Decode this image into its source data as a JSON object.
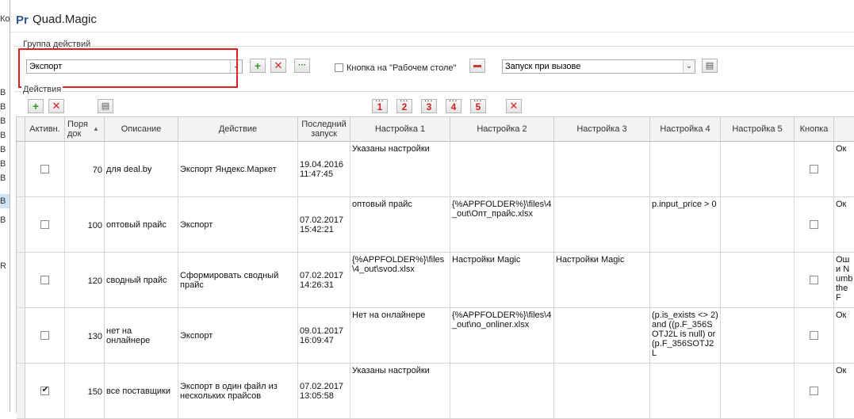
{
  "background_window": {
    "top_text": "Ко",
    "rows": [
      "B",
      "B",
      "B",
      "B",
      "B",
      "B",
      "B",
      "B",
      "B",
      "R"
    ]
  },
  "window": {
    "logo": "Pr",
    "title": "Quad.Magic"
  },
  "group_actions": {
    "label": "Группа действий",
    "combo_value": "Экспорт",
    "desktop_checkbox_label": "Кнопка на \"Рабочем столе\"",
    "launch_combo_value": "Запуск при вызове"
  },
  "actions": {
    "label": "Действия",
    "number_buttons": [
      "1",
      "2",
      "3",
      "4",
      "5"
    ]
  },
  "grid": {
    "columns": [
      "Активн.",
      "Поря док",
      "Описание",
      "Действие",
      "Последний запуск",
      "Настройка 1",
      "Настройка 2",
      "Настройка 3",
      "Настройка 4",
      "Настройка 5",
      "Кнопка",
      ""
    ],
    "sort_indicator": "▲",
    "rows": [
      {
        "active": false,
        "order": "70",
        "description": "для deal.by",
        "action": "Экспорт Яндекс.Маркет",
        "last_run": "19.04.2016 11:47:45",
        "s1": "Указаны настройки",
        "s2": "",
        "s3": "",
        "s4": "",
        "s5": "",
        "button": false,
        "extra": "Ок"
      },
      {
        "active": false,
        "order": "100",
        "description": "оптовый прайс",
        "action": "Экспорт",
        "last_run": "07.02.2017 15:42:21",
        "s1": "оптовый прайс",
        "s2": "{%APPFOLDER%}\\files\\4_out\\Опт_прайс.xlsx",
        "s3": "",
        "s4": "p.input_price > 0",
        "s5": "",
        "button": false,
        "extra": "Ок"
      },
      {
        "active": false,
        "order": "120",
        "description": "сводный прайс",
        "action": "Сформировать сводный прайс",
        "last_run": "07.02.2017 14:26:31",
        "s1": "{%APPFOLDER%}\\files\\4_out\\svod.xlsx",
        "s2": "Настройки Magic",
        "s3": "Настройки Magic",
        "s4": "",
        "s5": "",
        "button": false,
        "extra": "Оши Numb the F"
      },
      {
        "active": false,
        "order": "130",
        "description": "нет на онлайнере",
        "action": "Экспорт",
        "last_run": "09.01.2017 16:09:47",
        "s1": "Нет на онлайнере",
        "s2": "{%APPFOLDER%}\\files\\4_out\\no_onliner.xlsx",
        "s3": "",
        "s4": "(p.is_exists <> 2) and ((p.F_356SOTJ2L is null) or (p.F_356SOTJ2L",
        "s5": "",
        "button": false,
        "extra": "Ок"
      },
      {
        "active": true,
        "order": "150",
        "description": "все поставщики",
        "action": "Экспорт в один файл из нескольких прайсов",
        "last_run": "07.02.2017 13:05:58",
        "s1": "Указаны настройки",
        "s2": "",
        "s3": "",
        "s4": "",
        "s5": "",
        "button": false,
        "extra": "Ок"
      }
    ]
  },
  "colors": {
    "highlight": "#e02020",
    "accent_add": "#3c9a2e",
    "accent_remove": "#d02020"
  }
}
